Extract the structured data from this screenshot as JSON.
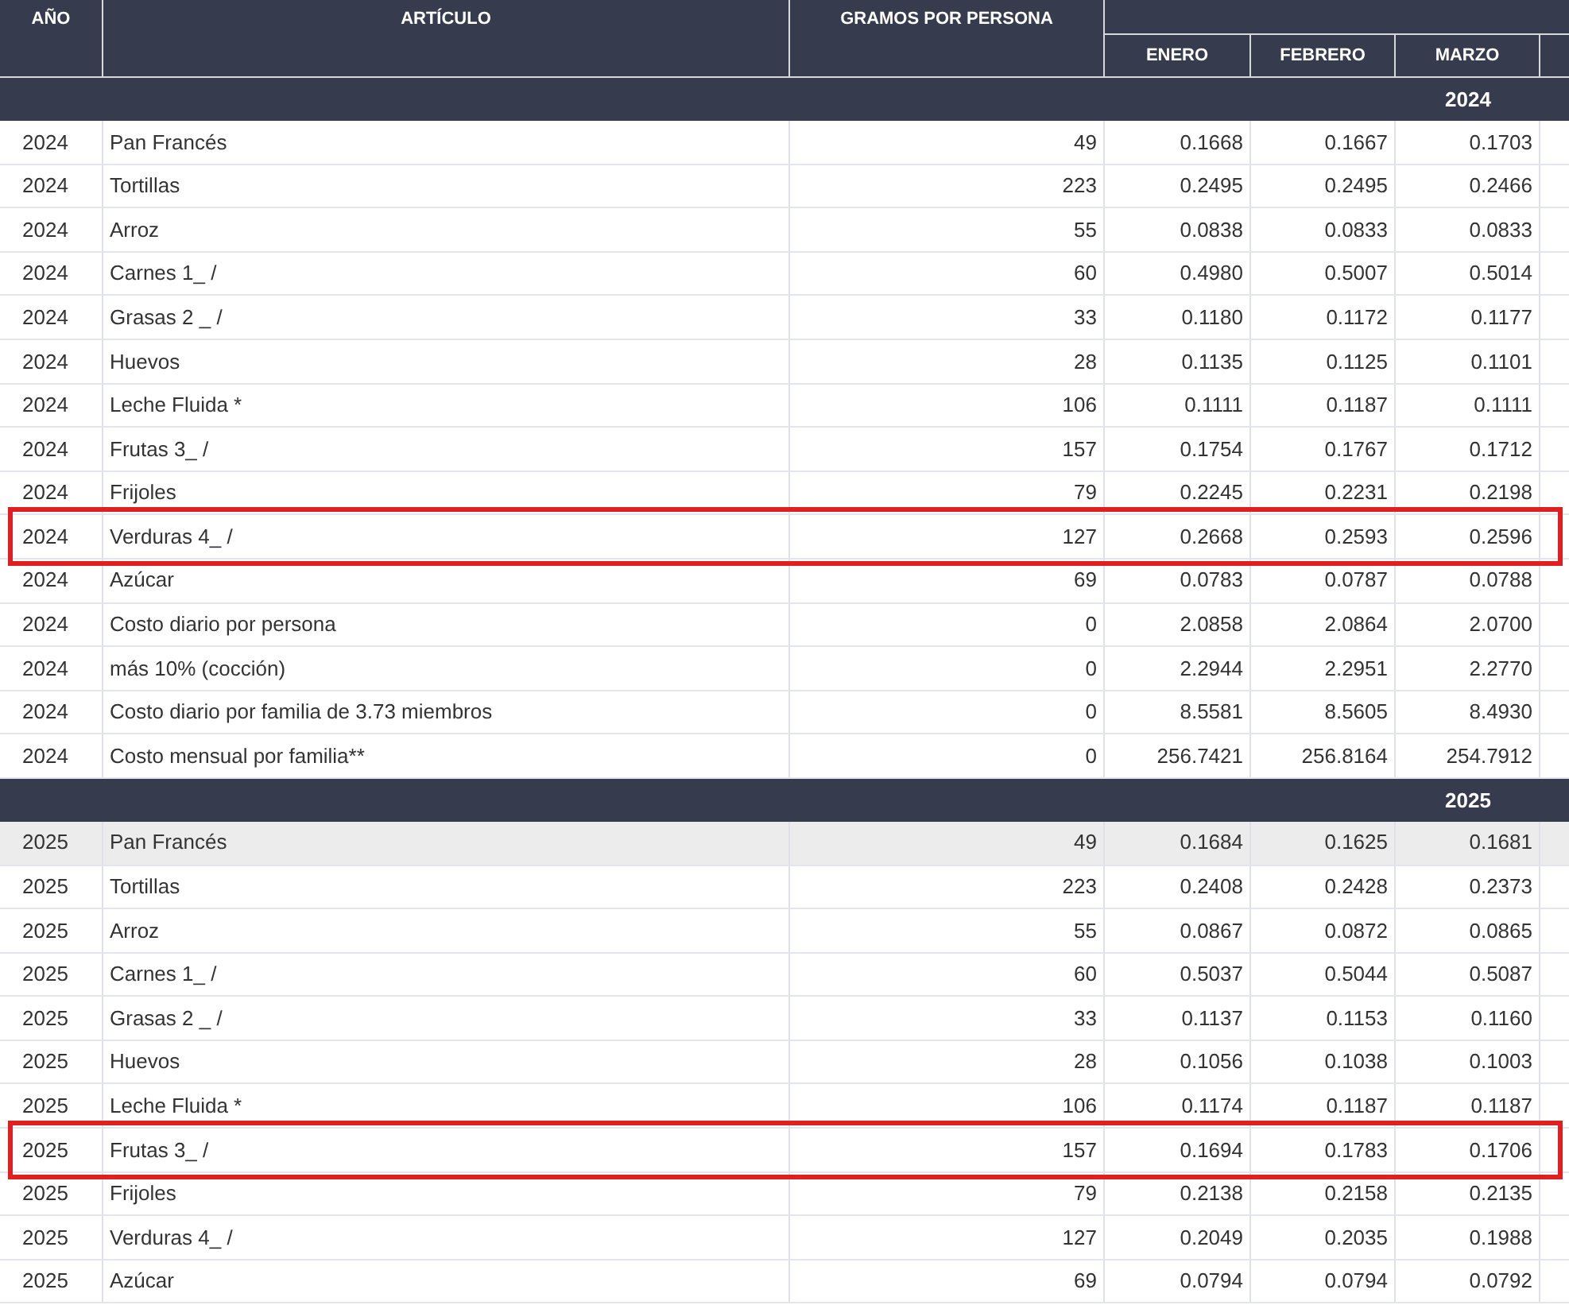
{
  "columns": {
    "year": "AÑO",
    "article": "ARTÍCULO",
    "grams": "GRAMOS POR PERSONA",
    "months": [
      "ENERO",
      "FEBRERO",
      "MARZO"
    ]
  },
  "groups": [
    {
      "label": "2024",
      "rows": [
        {
          "year": "2024",
          "article": "Pan Francés",
          "grams": "49",
          "values": [
            "0.1668",
            "0.1667",
            "0.1703"
          ],
          "highlighted": false,
          "hovered": false
        },
        {
          "year": "2024",
          "article": "Tortillas",
          "grams": "223",
          "values": [
            "0.2495",
            "0.2495",
            "0.2466"
          ],
          "highlighted": false,
          "hovered": false
        },
        {
          "year": "2024",
          "article": "Arroz",
          "grams": "55",
          "values": [
            "0.0838",
            "0.0833",
            "0.0833"
          ],
          "highlighted": false,
          "hovered": false
        },
        {
          "year": "2024",
          "article": "Carnes 1_ /",
          "grams": "60",
          "values": [
            "0.4980",
            "0.5007",
            "0.5014"
          ],
          "highlighted": false,
          "hovered": false
        },
        {
          "year": "2024",
          "article": "Grasas 2 _ /",
          "grams": "33",
          "values": [
            "0.1180",
            "0.1172",
            "0.1177"
          ],
          "highlighted": false,
          "hovered": false
        },
        {
          "year": "2024",
          "article": "Huevos",
          "grams": "28",
          "values": [
            "0.1135",
            "0.1125",
            "0.1101"
          ],
          "highlighted": false,
          "hovered": false
        },
        {
          "year": "2024",
          "article": "Leche Fluida *",
          "grams": "106",
          "values": [
            "0.1111",
            "0.1187",
            "0.1111"
          ],
          "highlighted": false,
          "hovered": false
        },
        {
          "year": "2024",
          "article": "Frutas 3_ /",
          "grams": "157",
          "values": [
            "0.1754",
            "0.1767",
            "0.1712"
          ],
          "highlighted": false,
          "hovered": false
        },
        {
          "year": "2024",
          "article": "Frijoles",
          "grams": "79",
          "values": [
            "0.2245",
            "0.2231",
            "0.2198"
          ],
          "highlighted": false,
          "hovered": false
        },
        {
          "year": "2024",
          "article": "Verduras 4_ /",
          "grams": "127",
          "values": [
            "0.2668",
            "0.2593",
            "0.2596"
          ],
          "highlighted": true,
          "hovered": false
        },
        {
          "year": "2024",
          "article": "Azúcar",
          "grams": "69",
          "values": [
            "0.0783",
            "0.0787",
            "0.0788"
          ],
          "highlighted": false,
          "hovered": false
        },
        {
          "year": "2024",
          "article": "Costo diario por persona",
          "grams": "0",
          "values": [
            "2.0858",
            "2.0864",
            "2.0700"
          ],
          "highlighted": false,
          "hovered": false
        },
        {
          "year": "2024",
          "article": "más 10% (cocción)",
          "grams": "0",
          "values": [
            "2.2944",
            "2.2951",
            "2.2770"
          ],
          "highlighted": false,
          "hovered": false
        },
        {
          "year": "2024",
          "article": "Costo diario por familia de 3.73 miembros",
          "grams": "0",
          "values": [
            "8.5581",
            "8.5605",
            "8.4930"
          ],
          "highlighted": false,
          "hovered": false
        },
        {
          "year": "2024",
          "article": "Costo mensual por familia**",
          "grams": "0",
          "values": [
            "256.7421",
            "256.8164",
            "254.7912"
          ],
          "highlighted": false,
          "hovered": false
        }
      ]
    },
    {
      "label": "2025",
      "rows": [
        {
          "year": "2025",
          "article": "Pan Francés",
          "grams": "49",
          "values": [
            "0.1684",
            "0.1625",
            "0.1681"
          ],
          "highlighted": false,
          "hovered": true
        },
        {
          "year": "2025",
          "article": "Tortillas",
          "grams": "223",
          "values": [
            "0.2408",
            "0.2428",
            "0.2373"
          ],
          "highlighted": false,
          "hovered": false
        },
        {
          "year": "2025",
          "article": "Arroz",
          "grams": "55",
          "values": [
            "0.0867",
            "0.0872",
            "0.0865"
          ],
          "highlighted": false,
          "hovered": false
        },
        {
          "year": "2025",
          "article": "Carnes 1_ /",
          "grams": "60",
          "values": [
            "0.5037",
            "0.5044",
            "0.5087"
          ],
          "highlighted": false,
          "hovered": false
        },
        {
          "year": "2025",
          "article": "Grasas 2 _ /",
          "grams": "33",
          "values": [
            "0.1137",
            "0.1153",
            "0.1160"
          ],
          "highlighted": false,
          "hovered": false
        },
        {
          "year": "2025",
          "article": "Huevos",
          "grams": "28",
          "values": [
            "0.1056",
            "0.1038",
            "0.1003"
          ],
          "highlighted": false,
          "hovered": false
        },
        {
          "year": "2025",
          "article": "Leche Fluida *",
          "grams": "106",
          "values": [
            "0.1174",
            "0.1187",
            "0.1187"
          ],
          "highlighted": false,
          "hovered": false
        },
        {
          "year": "2025",
          "article": "Frutas 3_ /",
          "grams": "157",
          "values": [
            "0.1694",
            "0.1783",
            "0.1706"
          ],
          "highlighted": true,
          "hovered": false
        },
        {
          "year": "2025",
          "article": "Frijoles",
          "grams": "79",
          "values": [
            "0.2138",
            "0.2158",
            "0.2135"
          ],
          "highlighted": false,
          "hovered": false
        },
        {
          "year": "2025",
          "article": "Verduras 4_ /",
          "grams": "127",
          "values": [
            "0.2049",
            "0.2035",
            "0.1988"
          ],
          "highlighted": false,
          "hovered": false
        },
        {
          "year": "2025",
          "article": "Azúcar",
          "grams": "69",
          "values": [
            "0.0794",
            "0.0794",
            "0.0792"
          ],
          "highlighted": false,
          "hovered": false
        }
      ]
    }
  ]
}
